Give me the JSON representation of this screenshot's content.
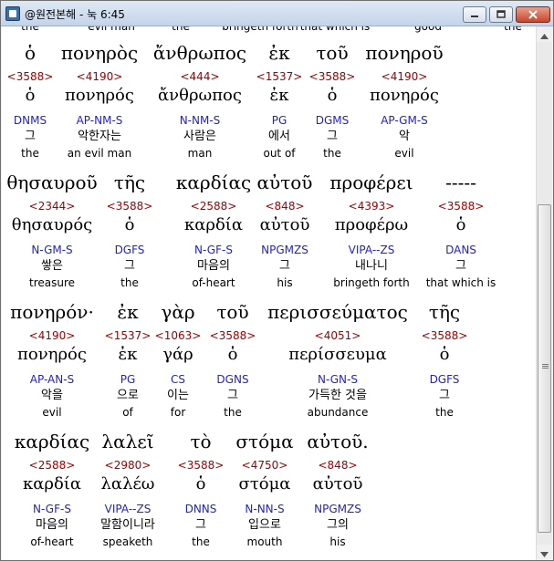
{
  "window": {
    "title": "@원전본해 - 눅 6:45",
    "buttons": [
      "minimize-icon",
      "maximize-icon",
      "close-icon"
    ]
  },
  "top_cut": [
    "the",
    "evil man",
    "the",
    "bringeth forth",
    "that which is",
    "good",
    "the"
  ],
  "blocks": [
    {
      "words": [
        {
          "greek": "ὁ",
          "strong": "<3588>",
          "lemma": "ὁ",
          "morph": "DNMS",
          "kor": "그",
          "eng": "the"
        },
        {
          "greek": "πονηρὸς",
          "strong": "<4190>",
          "lemma": "πονηρός",
          "morph": "AP-NM-S",
          "kor": "악한자는",
          "eng": "an evil man"
        },
        {
          "greek": "ἄνθρωπος",
          "strong": "<444>",
          "lemma": "ἄνθρωπος",
          "morph": "N-NM-S",
          "kor": "사람은",
          "eng": "man"
        },
        {
          "greek": "ἐκ",
          "strong": "<1537>",
          "lemma": "ἐκ",
          "morph": "PG",
          "kor": "에서",
          "eng": "out of"
        },
        {
          "greek": "τοῦ",
          "strong": "<3588>",
          "lemma": "ὁ",
          "morph": "DGMS",
          "kor": "그",
          "eng": "the"
        },
        {
          "greek": "πονηροῦ",
          "strong": "<4190>",
          "lemma": "πονηρός",
          "morph": "AP-GM-S",
          "kor": "악",
          "eng": "evil"
        }
      ]
    },
    {
      "words": [
        {
          "greek": "θησαυροῦ",
          "strong": "<2344>",
          "lemma": "θησαυρός",
          "morph": "N-GM-S",
          "kor": "쌓은",
          "eng": "treasure"
        },
        {
          "greek": "τῆς",
          "strong": "<3588>",
          "lemma": "ὁ",
          "morph": "DGFS",
          "kor": "그",
          "eng": "the"
        },
        {
          "greek": "καρδίας",
          "strong": "<2588>",
          "lemma": "καρδία",
          "morph": "N-GF-S",
          "kor": "마음의",
          "eng": "of-heart"
        },
        {
          "greek": "αὐτοῦ",
          "strong": "<848>",
          "lemma": "αὐτοῦ",
          "morph": "NPGMZS",
          "kor": "그",
          "eng": "his"
        },
        {
          "greek": "προφέρει",
          "strong": "<4393>",
          "lemma": "προφέρω",
          "morph": "VIPA--ZS",
          "kor": "내나니",
          "eng": "bringeth forth"
        },
        {
          "greek": "-----",
          "strong": "<3588>",
          "lemma": "ὁ",
          "morph": "DANS",
          "kor": "그",
          "eng": "that which is"
        }
      ]
    },
    {
      "words": [
        {
          "greek": "πονηρόν·",
          "strong": "<4190>",
          "lemma": "πονηρός",
          "morph": "AP-AN-S",
          "kor": "악을",
          "eng": "evil"
        },
        {
          "greek": "ἐκ",
          "strong": "<1537>",
          "lemma": "ἐκ",
          "morph": "PG",
          "kor": "으로",
          "eng": "of"
        },
        {
          "greek": "γὰρ",
          "strong": "<1063>",
          "lemma": "γάρ",
          "morph": "CS",
          "kor": "이는",
          "eng": "for"
        },
        {
          "greek": "τοῦ",
          "strong": "<3588>",
          "lemma": "ὁ",
          "morph": "DGNS",
          "kor": "그",
          "eng": "the"
        },
        {
          "greek": "περισσεύματος",
          "strong": "<4051>",
          "lemma": "περίσσευμα",
          "morph": "N-GN-S",
          "kor": "가득한 것을",
          "eng": "abundance"
        },
        {
          "greek": "τῆς",
          "strong": "<3588>",
          "lemma": "ὁ",
          "morph": "DGFS",
          "kor": "그",
          "eng": "the"
        }
      ]
    },
    {
      "words": [
        {
          "greek": "καρδίας",
          "strong": "<2588>",
          "lemma": "καρδία",
          "morph": "N-GF-S",
          "kor": "마음의",
          "eng": "of-heart"
        },
        {
          "greek": "λαλεῖ",
          "strong": "<2980>",
          "lemma": "λαλέω",
          "morph": "VIPA--ZS",
          "kor": "말함이니라",
          "eng": "speaketh"
        },
        {
          "greek": "τὸ",
          "strong": "<3588>",
          "lemma": "ὁ",
          "morph": "DNNS",
          "kor": "그",
          "eng": "the"
        },
        {
          "greek": "στόμα",
          "strong": "<4750>",
          "lemma": "στόμα",
          "morph": "N-NN-S",
          "kor": "입으로",
          "eng": "mouth"
        },
        {
          "greek": "αὐτοῦ.",
          "strong": "<848>",
          "lemma": "αὐτοῦ",
          "morph": "NPGMZS",
          "kor": "그의",
          "eng": "his"
        }
      ]
    }
  ]
}
